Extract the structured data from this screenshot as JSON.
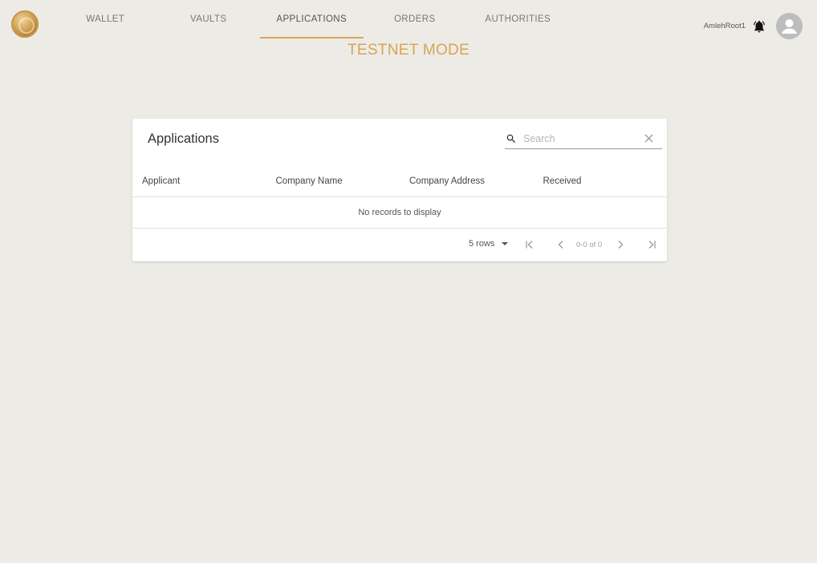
{
  "nav": {
    "items": [
      {
        "label": "WALLET",
        "active": false
      },
      {
        "label": "VAULTS",
        "active": false
      },
      {
        "label": "APPLICATIONS",
        "active": true
      },
      {
        "label": "ORDERS",
        "active": false
      },
      {
        "label": "AUTHORITIES",
        "active": false
      }
    ]
  },
  "mode_banner": "TESTNET MODE",
  "user": {
    "name": "AmlehRoot1",
    "icons": [
      "bell-icon",
      "avatar-icon"
    ]
  },
  "card": {
    "title": "Applications",
    "search": {
      "value": "",
      "placeholder": "Search"
    },
    "columns": [
      "Applicant",
      "Company Name",
      "Company Address",
      "Received"
    ],
    "empty_message": "No records to display",
    "pagination": {
      "rows_label": "5 rows",
      "range_text": "0-0 of 0"
    }
  },
  "colors": {
    "accent": "#d9a552",
    "background": "#edebe6",
    "card": "#ffffff"
  }
}
